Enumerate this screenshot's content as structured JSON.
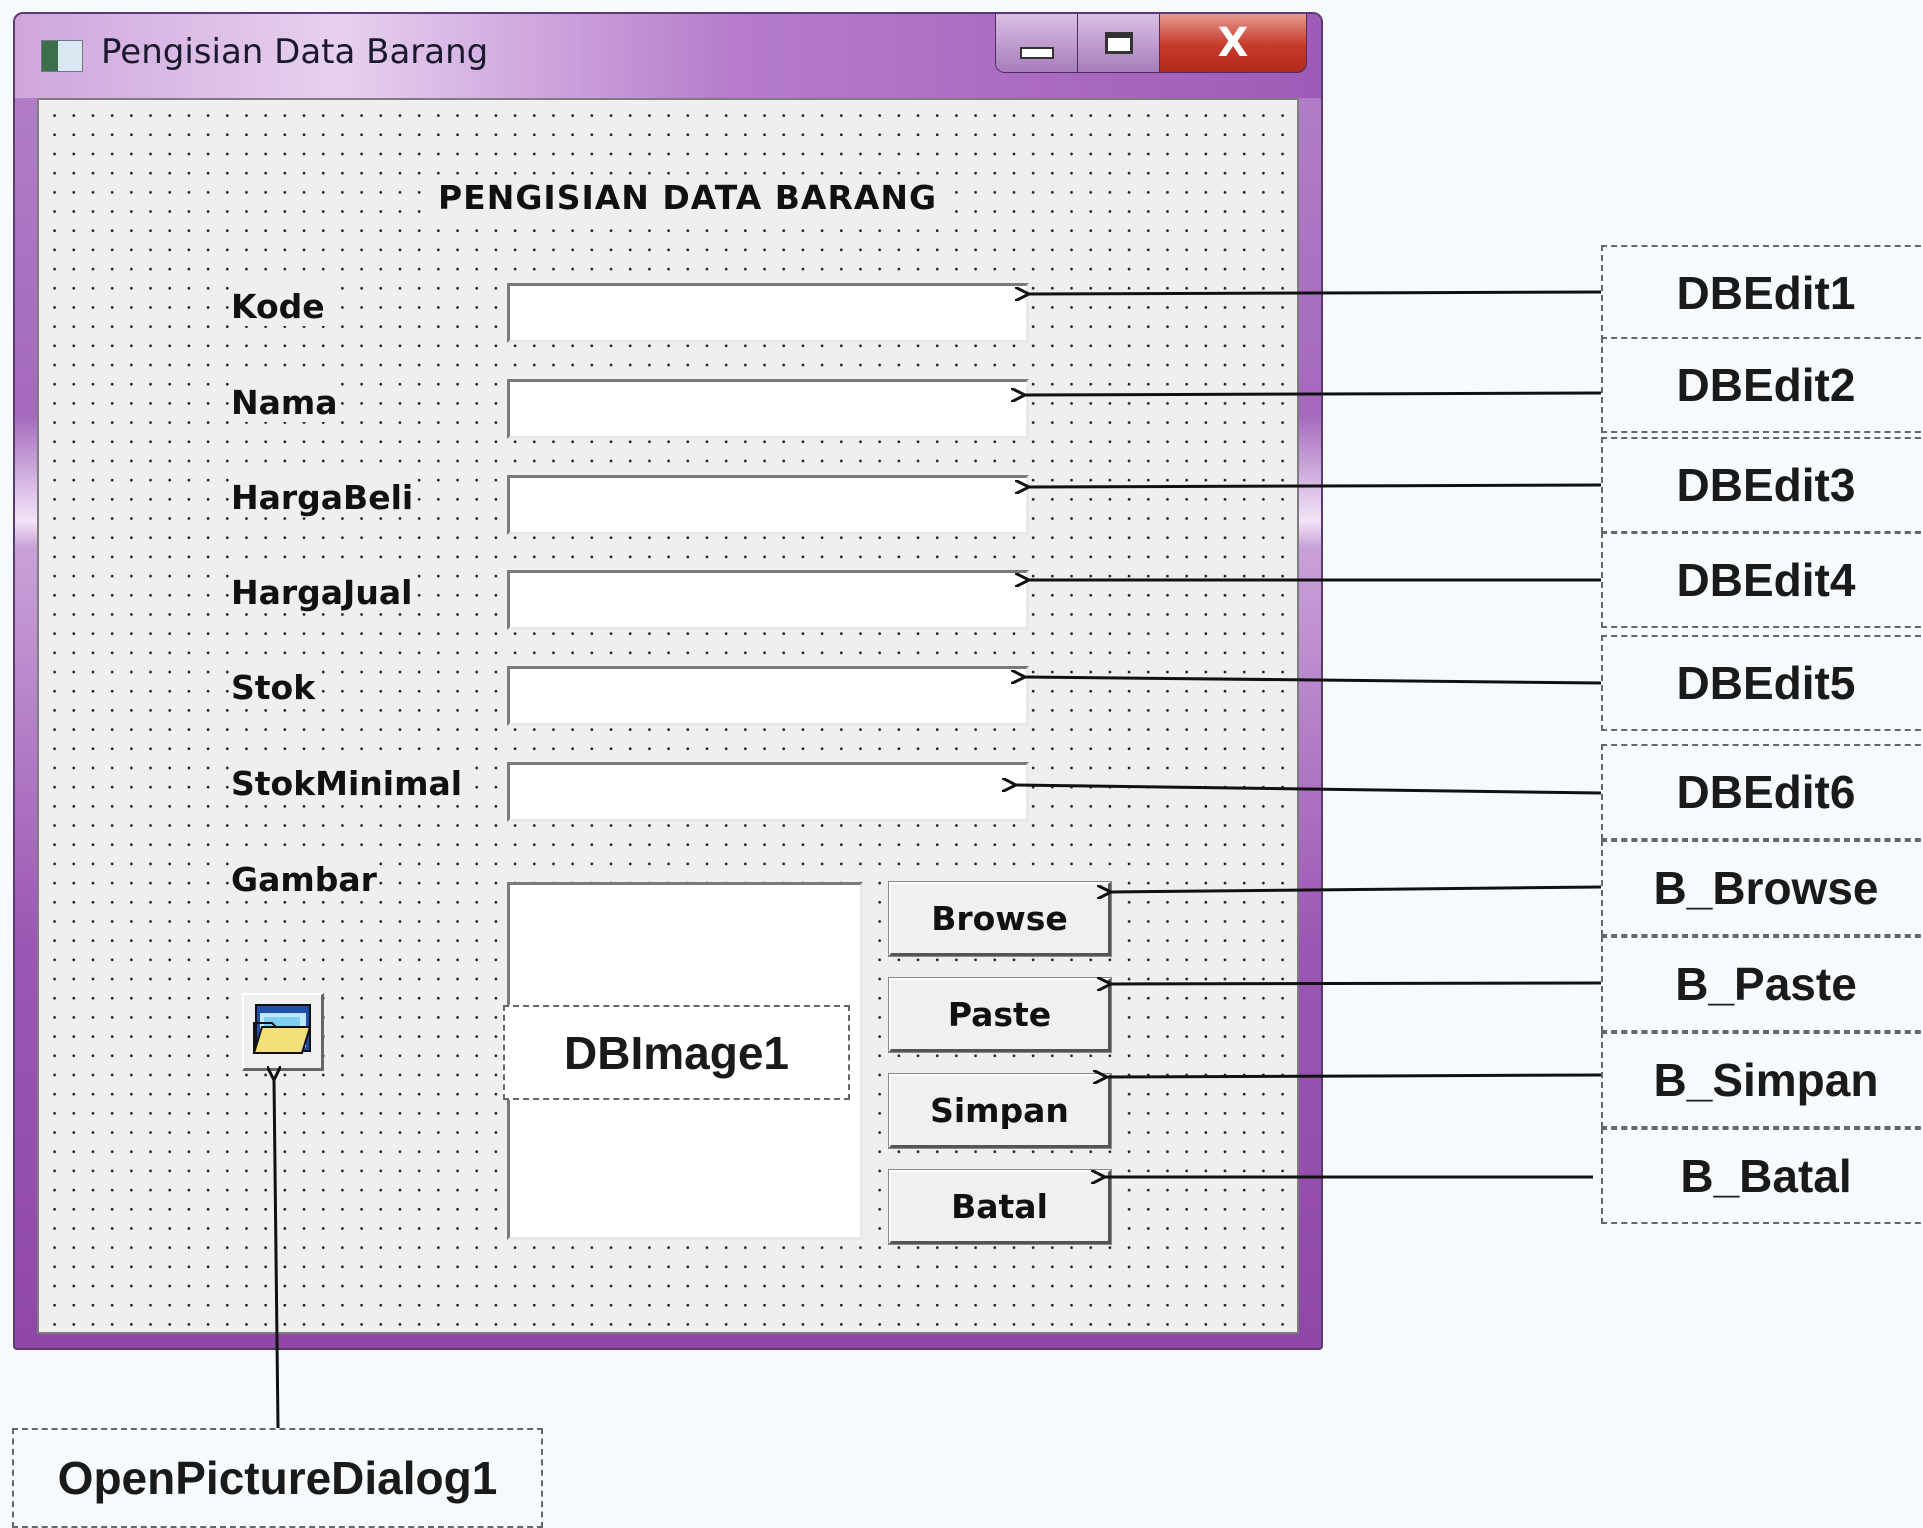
{
  "window": {
    "title": "Pengisian Data Barang",
    "close_glyph": "X"
  },
  "form": {
    "heading": "PENGISIAN DATA BARANG",
    "labels": {
      "kode": "Kode",
      "nama": "Nama",
      "harga_beli": "HargaBeli",
      "harga_jual": "HargaJual",
      "stok": "Stok",
      "stok_minimal": "StokMinimal",
      "gambar": "Gambar"
    },
    "fields": {
      "kode": "",
      "nama": "",
      "harga_beli": "",
      "harga_jual": "",
      "stok": "",
      "stok_minimal": ""
    },
    "buttons": {
      "browse": "Browse",
      "paste": "Paste",
      "simpan": "Simpan",
      "batal": "Batal"
    },
    "dialog_icon": "open-folder-icon"
  },
  "annotations": {
    "dbedit1": "DBEdit1",
    "dbedit2": "DBEdit2",
    "dbedit3": "DBEdit3",
    "dbedit4": "DBEdit4",
    "dbedit5": "DBEdit5",
    "dbedit6": "DBEdit6",
    "b_browse": "B_Browse",
    "b_paste": "B_Paste",
    "b_simpan": "B_Simpan",
    "b_batal": "B_Batal",
    "dbimage1": "DBImage1",
    "open_picture_dialog": "OpenPictureDialog1"
  },
  "colors": {
    "window_frame": "#9b56b3",
    "close_button": "#c4392a",
    "form_background": "#efefef"
  }
}
